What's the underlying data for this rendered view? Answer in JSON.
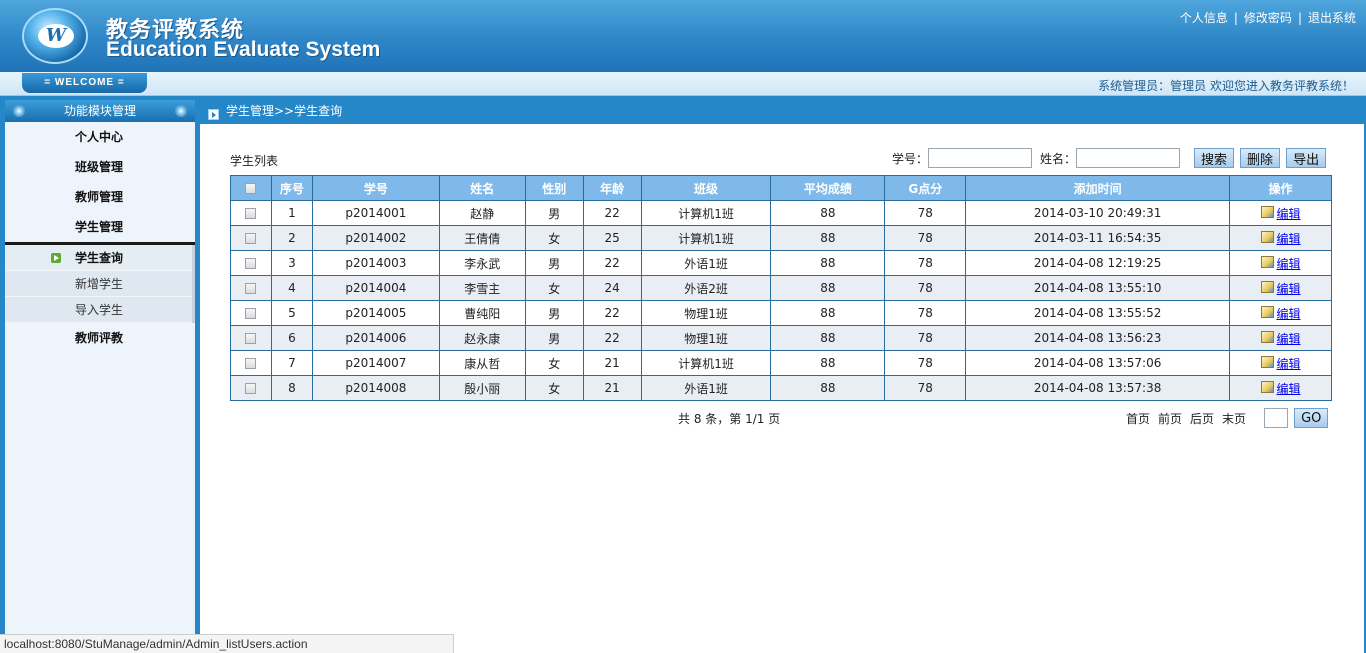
{
  "header": {
    "title_cn": "教务评教系统",
    "title_en": "Education Evaluate System",
    "links": [
      "个人信息",
      "修改密码",
      "退出系统"
    ],
    "separator": "|"
  },
  "welcome": {
    "tab_label": "= WELCOME =",
    "message": "系统管理员：管理员   欢迎您进入教务评教系统！"
  },
  "sidebar": {
    "heading": "功能模块管理",
    "items": [
      "个人中心",
      "班级管理",
      "教师管理",
      "学生管理"
    ],
    "sub_items": [
      "学生查询",
      "新增学生",
      "导入学生"
    ],
    "bottom_item": "教师评教"
  },
  "breadcrumb": "学生管理>>学生查询",
  "list": {
    "title": "学生列表",
    "student_id_label": "学号：",
    "name_label": "姓名：",
    "student_id_value": "",
    "name_value": "",
    "search_button": "搜索",
    "delete_button": "删除",
    "export_button": "导出"
  },
  "table": {
    "headers": [
      "序号",
      "学号",
      "姓名",
      "性别",
      "年龄",
      "班级",
      "平均成绩",
      "G点分",
      "添加时间",
      "操作"
    ],
    "edit_label": "编辑",
    "rows": [
      [
        "1",
        "p2014001",
        "赵静",
        "男",
        "22",
        "计算机1班",
        "88",
        "78",
        "2014-03-10 20:49:31"
      ],
      [
        "2",
        "p2014002",
        "王倩倩",
        "女",
        "25",
        "计算机1班",
        "88",
        "78",
        "2014-03-11 16:54:35"
      ],
      [
        "3",
        "p2014003",
        "李永武",
        "男",
        "22",
        "外语1班",
        "88",
        "78",
        "2014-04-08 12:19:25"
      ],
      [
        "4",
        "p2014004",
        "李雪主",
        "女",
        "24",
        "外语2班",
        "88",
        "78",
        "2014-04-08 13:55:10"
      ],
      [
        "5",
        "p2014005",
        "曹纯阳",
        "男",
        "22",
        "物理1班",
        "88",
        "78",
        "2014-04-08 13:55:52"
      ],
      [
        "6",
        "p2014006",
        "赵永康",
        "男",
        "22",
        "物理1班",
        "88",
        "78",
        "2014-04-08 13:56:23"
      ],
      [
        "7",
        "p2014007",
        "康从哲",
        "女",
        "21",
        "计算机1班",
        "88",
        "78",
        "2014-04-08 13:57:06"
      ],
      [
        "8",
        "p2014008",
        "殷小丽",
        "女",
        "21",
        "外语1班",
        "88",
        "78",
        "2014-04-08 13:57:38"
      ]
    ]
  },
  "pager": {
    "info": "共 8 条，第 1/1 页",
    "first": "首页",
    "prev": "前页",
    "next": "后页",
    "last": "末页",
    "page_value": "",
    "go_button": "GO"
  },
  "statusbar": "localhost:8080/StuManage/admin/Admin_listUsers.action",
  "colors": {
    "header_blue": "#2e86c8",
    "table_header": "#7fb9ea",
    "link": "#0000ee"
  }
}
